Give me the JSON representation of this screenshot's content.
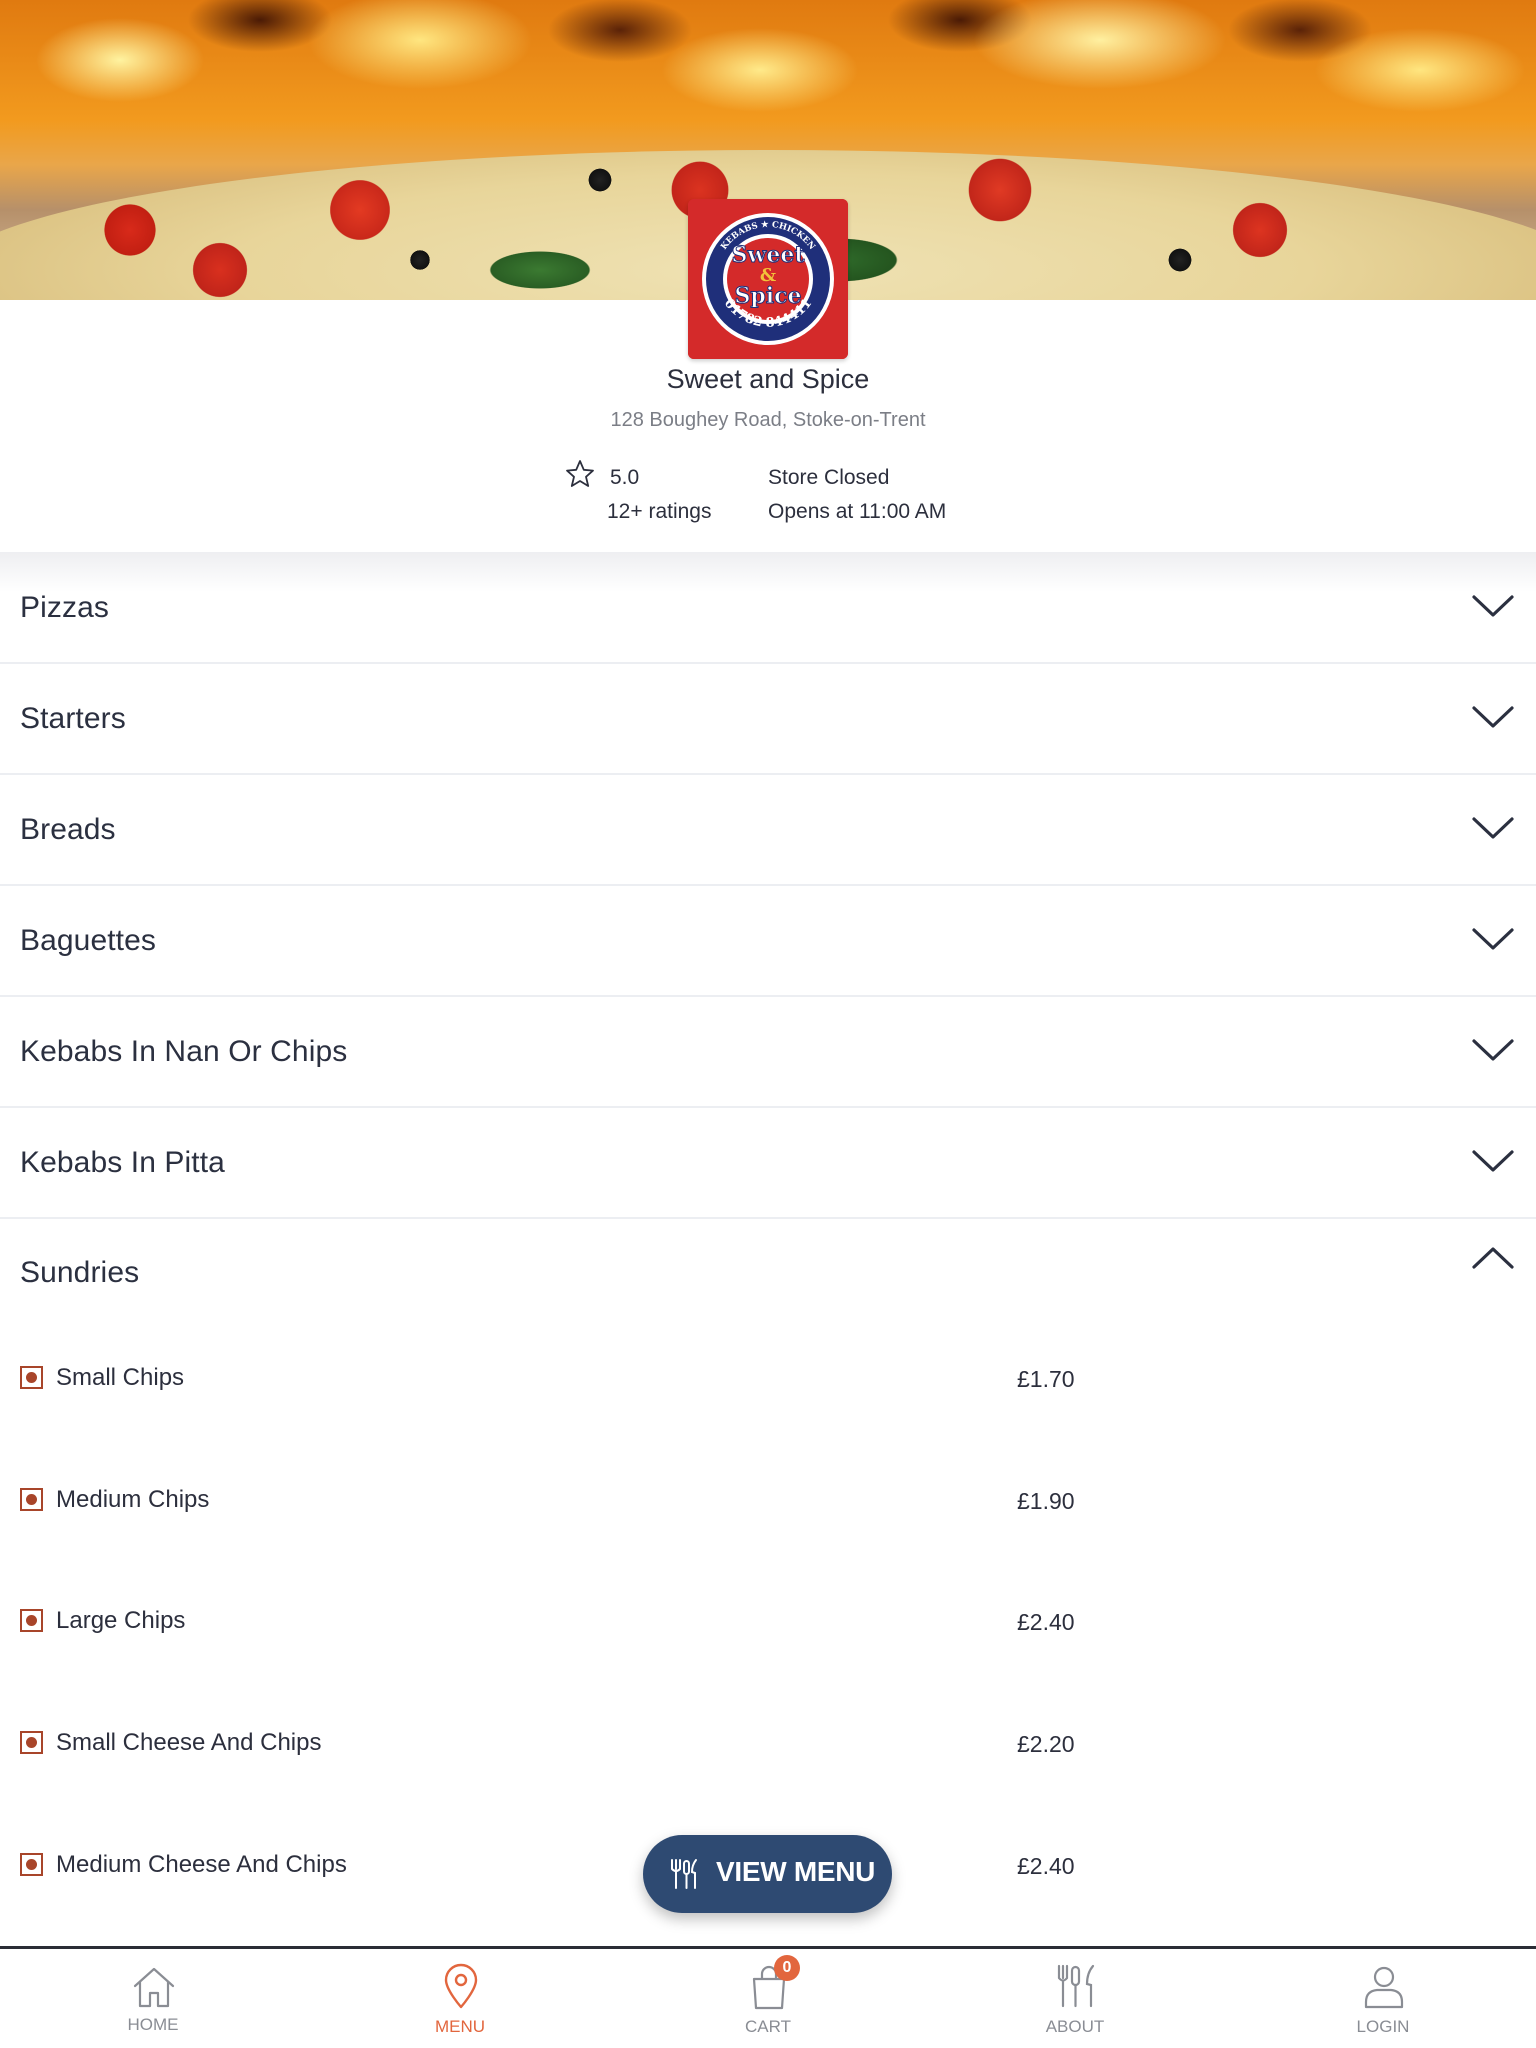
{
  "store": {
    "name": "Sweet and Spice",
    "address": "128 Boughey Road, Stoke-on-Trent",
    "rating": "5.0",
    "rating_count": "12+ ratings",
    "status": "Store Closed",
    "opens_at": "Opens at 11:00 AM",
    "logo": {
      "line1": "Sweet",
      "line2": "&",
      "line3": "Spice",
      "phone": "01782 844411",
      "ring_top": "KEBABS ★ CHICKEN",
      "ring_left": "PIZZAS",
      "ring_right": "MITHAI"
    }
  },
  "categories": [
    {
      "label": "Pizzas",
      "expanded": false
    },
    {
      "label": "Starters",
      "expanded": false
    },
    {
      "label": "Breads",
      "expanded": false
    },
    {
      "label": "Baguettes",
      "expanded": false
    },
    {
      "label": "Kebabs In Nan Or Chips",
      "expanded": false
    },
    {
      "label": "Kebabs In Pitta",
      "expanded": false
    },
    {
      "label": "Sundries",
      "expanded": true
    }
  ],
  "sundries_items": [
    {
      "name": "Small Chips",
      "price": "£1.70"
    },
    {
      "name": "Medium Chips",
      "price": "£1.90"
    },
    {
      "name": "Large Chips",
      "price": "£2.40"
    },
    {
      "name": "Small Cheese And Chips",
      "price": "£2.20"
    },
    {
      "name": "Medium Cheese And Chips",
      "price": "£2.40"
    }
  ],
  "view_menu_button": {
    "label": "VIEW MENU"
  },
  "bottom_nav": {
    "items": [
      {
        "label": "HOME",
        "icon": "home-icon"
      },
      {
        "label": "MENU",
        "icon": "map-pin-icon",
        "active": true
      },
      {
        "label": "CART",
        "icon": "shopping-bag-icon",
        "badge": "0"
      },
      {
        "label": "ABOUT",
        "icon": "cutlery-icon"
      },
      {
        "label": "LOGIN",
        "icon": "user-icon"
      }
    ]
  },
  "colors": {
    "accent": "#e2663e",
    "button": "#2e4a72",
    "text": "#2c2f3d",
    "muted": "#7b7e86",
    "veg_mark": "#a8452a",
    "logo_red": "#d42a2a",
    "logo_blue": "#1f2f7a"
  }
}
